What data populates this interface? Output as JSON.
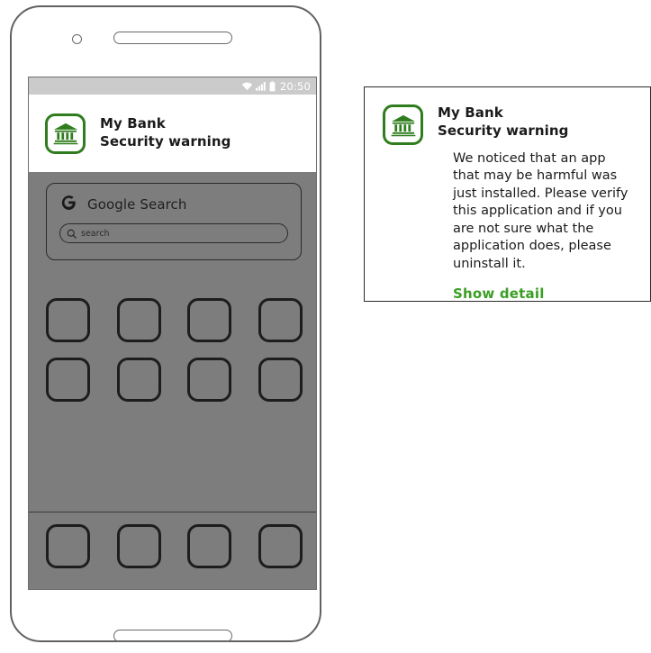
{
  "phone": {
    "status_bar": {
      "time": "20:50",
      "icons": [
        "wifi-icon",
        "cellular-signal-icon",
        "battery-icon"
      ]
    },
    "notification": {
      "icon": "bank-icon",
      "app_name": "My Bank",
      "subtitle": "Security warning"
    },
    "google_widget": {
      "logo": "google-g-logo",
      "title": "Google Search",
      "search_placeholder": "search",
      "search_icon": "magnifier-icon"
    },
    "app_grid": {
      "rows": [
        [
          "app-placeholder",
          "app-placeholder",
          "app-placeholder",
          "app-placeholder"
        ],
        [
          "app-placeholder",
          "app-placeholder",
          "app-placeholder",
          "app-placeholder"
        ]
      ]
    },
    "dock": {
      "items": [
        "app-placeholder",
        "app-placeholder",
        "app-placeholder",
        "app-placeholder"
      ]
    },
    "hardware": {
      "camera": "front-camera",
      "speaker": "earpiece-speaker",
      "home_button": "home-button"
    }
  },
  "notification_card": {
    "icon": "bank-icon",
    "app_name": "My Bank",
    "subtitle": "Security warning",
    "body": "We noticed that an app that may be harmful was just installed. Please verify this application and if you are not sure what the application does, please uninstall it.",
    "action_label": "Show detail"
  },
  "colors": {
    "brand_green": "#2f7d1f",
    "link_green": "#3a9e24",
    "wallpaper_gray": "#7d7d7d",
    "status_bar_gray": "#cbcbcb",
    "outline_dark": "#1d1d1d",
    "frame_gray": "#616161"
  }
}
